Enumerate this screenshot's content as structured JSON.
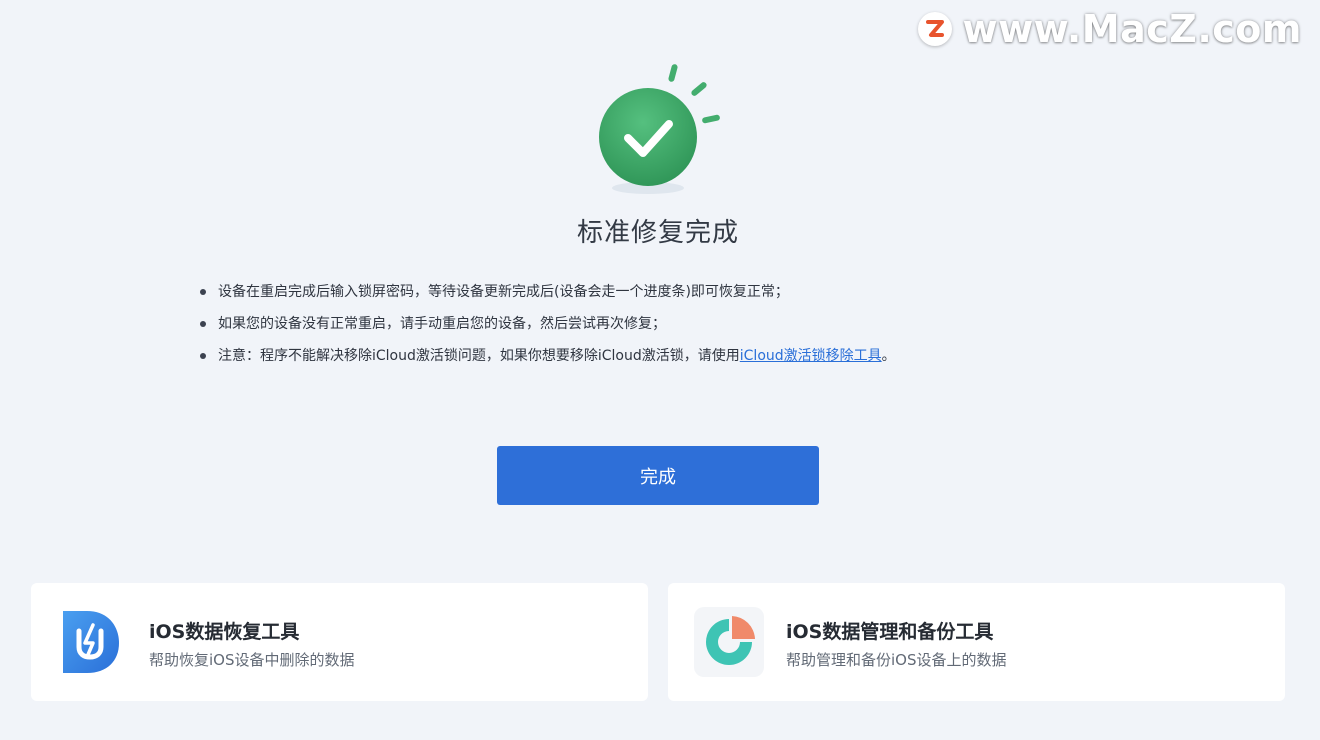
{
  "watermark": {
    "logo_letter": "Z",
    "text": "www.MacZ.com"
  },
  "status": {
    "title": "标准修复完成",
    "icon": "check-circle-icon"
  },
  "notes": [
    {
      "text": "设备在重启完成后输入锁屏密码，等待设备更新完成后(设备会走一个进度条)即可恢复正常；"
    },
    {
      "text": "如果您的设备没有正常重启，请手动重启您的设备，然后尝试再次修复；"
    },
    {
      "text": "注意：程序不能解决移除iCloud激活锁问题，如果你想要移除iCloud激活锁，请使用",
      "link": "iCloud激活锁移除工具",
      "suffix": "。"
    }
  ],
  "done_button": {
    "label": "完成"
  },
  "cards": [
    {
      "title": "iOS数据恢复工具",
      "subtitle": "帮助恢复iOS设备中删除的数据",
      "icon": "data-recovery-app-icon"
    },
    {
      "title": "iOS数据管理和备份工具",
      "subtitle": "帮助管理和备份iOS设备上的数据",
      "icon": "data-manager-app-icon"
    }
  ],
  "colors": {
    "background": "#f1f4f9",
    "accent_blue": "#2e6fd8",
    "success_green": "#3aa865",
    "link": "#2a6fd8"
  }
}
